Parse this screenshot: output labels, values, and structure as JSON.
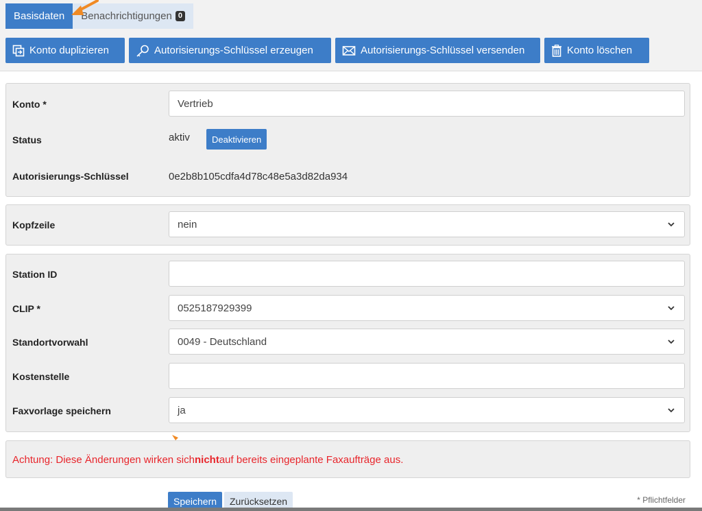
{
  "tabs": [
    {
      "label": "Basisdaten",
      "active": true
    },
    {
      "label": "Benachrichtigungen",
      "badge": "0",
      "active": false
    }
  ],
  "toolbar": {
    "duplicate": "Konto duplizieren",
    "create_key": "Autorisierungs-Schlüssel erzeugen",
    "send_key": "Autorisierungs-Schlüssel versenden",
    "delete": "Konto löschen"
  },
  "account": {
    "konto_label": "Konto *",
    "konto_value": "Vertrieb",
    "status_label": "Status",
    "status_value": "aktiv",
    "deactivate_label": "Deaktivieren",
    "key_label": "Autorisierungs-Schlüssel",
    "key_value": "0e2b8b105cdfa4d78c48e5a3d82da934"
  },
  "header": {
    "kopfzeile_label": "Kopfzeile",
    "kopfzeile_value": "nein"
  },
  "fax": {
    "station_label": "Station ID",
    "station_value": "",
    "clip_label": "CLIP *",
    "clip_value": "0525187929399",
    "area_label": "Standortvorwahl",
    "area_value": "0049 - Deutschland",
    "cost_label": "Kostenstelle",
    "cost_value": "",
    "template_label": "Faxvorlage speichern",
    "template_value": "ja"
  },
  "notice": {
    "before": "Achtung: Diese Änderungen wirken sich ",
    "bold": "nicht",
    "after": " auf bereits eingeplante Faxaufträge aus."
  },
  "actions": {
    "save": "Speichern",
    "reset": "Zurücksetzen",
    "required_note": "* Pflichtfelder"
  },
  "colors": {
    "primary": "#3d7dc8",
    "tab_inactive": "#dde7f3",
    "warning": "#e8252b",
    "panel_bg": "#efefef"
  }
}
